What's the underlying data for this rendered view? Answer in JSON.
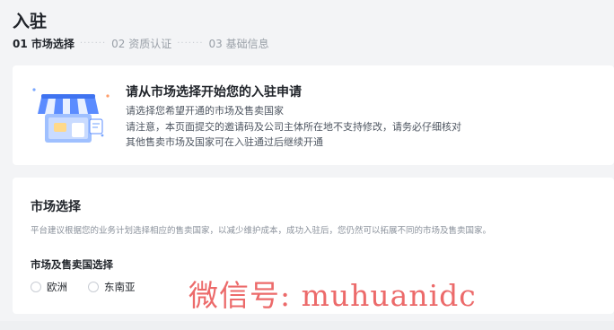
{
  "header": {
    "title": "入驻",
    "steps": [
      {
        "label": "01 市场选择",
        "active": true
      },
      {
        "label": "02 资质认证",
        "active": false
      },
      {
        "label": "03 基础信息",
        "active": false
      }
    ],
    "separator": "·······"
  },
  "intro": {
    "title": "请从市场选择开始您的入驻申请",
    "line1": "请选择您希望开通的市场及售卖国家",
    "line2": "请注意，本页面提交的邀请码及公司主体所在地不支持修改，请务必仔细核对",
    "line3": "其他售卖市场及国家可在入驻通过后继续开通",
    "illustration_icon": "storefront-icon"
  },
  "market": {
    "title": "市场选择",
    "description": "平台建议根据您的业务计划选择相应的售卖国家，以减少维护成本，成功入驻后，您仍然可以拓展不同的市场及售卖国家。",
    "field_label": "市场及售卖国选择",
    "options": [
      {
        "label": "欧洲",
        "selected": false
      },
      {
        "label": "东南亚",
        "selected": false
      }
    ]
  },
  "watermark": {
    "text": "微信号: muhuanidc"
  },
  "colors": {
    "accent": "#3370ff",
    "watermark": "#ec6a6a",
    "background": "#f3f4f6"
  }
}
